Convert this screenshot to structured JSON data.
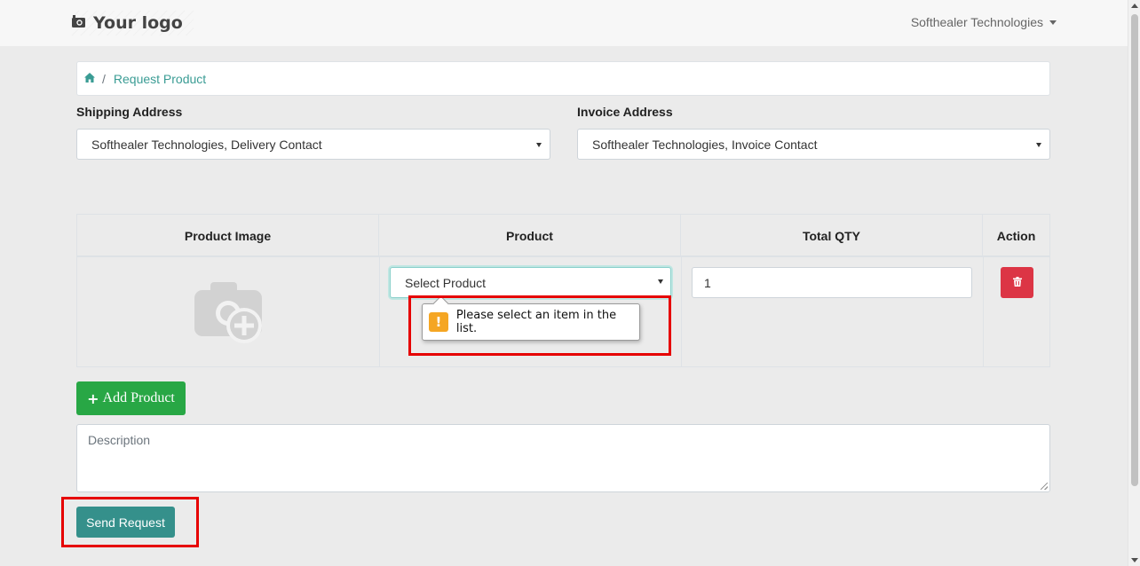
{
  "header": {
    "logo_text": "Your logo",
    "user_menu_label": "Softhealer Technologies"
  },
  "breadcrumb": {
    "current": "Request Product"
  },
  "shipping": {
    "label": "Shipping Address",
    "selected": "Softhealer Technologies, Delivery Contact"
  },
  "invoice": {
    "label": "Invoice Address",
    "selected": "Softhealer Technologies, Invoice Contact"
  },
  "table": {
    "columns": [
      "Product Image",
      "Product",
      "Total QTY",
      "Action"
    ],
    "row": {
      "product_placeholder": "Select Product",
      "qty": "1"
    }
  },
  "validation_tooltip": {
    "message": "Please select an item in the list."
  },
  "buttons": {
    "add_product": "Add Product",
    "send_request": "Send Request"
  },
  "description": {
    "placeholder": "Description"
  },
  "colors": {
    "accent_teal": "#3a9c94",
    "add_green": "#28a745",
    "delete_red": "#dc3545",
    "send_teal": "#35908b",
    "highlight_red": "#e60000"
  },
  "icons": [
    "camera-icon",
    "home-icon",
    "trash-icon",
    "plus-icon",
    "warning-icon",
    "image-placeholder-icon"
  ]
}
